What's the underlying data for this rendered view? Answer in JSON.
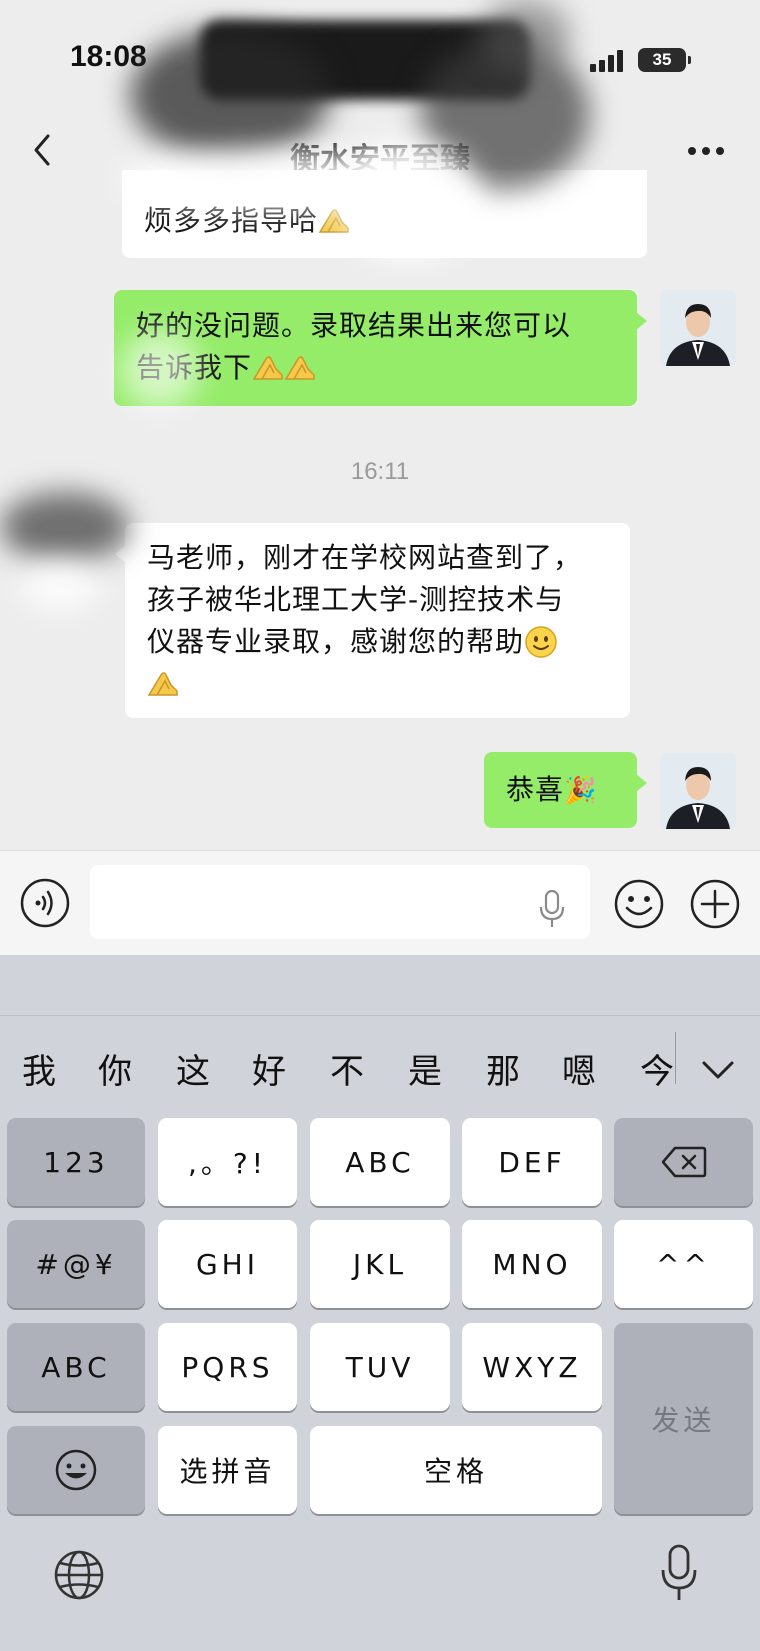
{
  "status_bar": {
    "time": "18:08",
    "battery": "35"
  },
  "nav": {
    "title": "衡水安平至臻"
  },
  "messages": {
    "m1_tail": "烦多多指导哈",
    "m2_line1": "好的没问题。录取结果出来您可以",
    "m2_line2": "告诉我下",
    "timestamp": "16:11",
    "m3_line1": "马老师，刚才在学校网站查到了，",
    "m3_line2": "孩子被华北理工大学-测控技术与",
    "m3_line3": "仪器专业录取，感谢您的帮助",
    "m4_text": "恭喜",
    "m4_emoji": "🎉"
  },
  "input": {
    "value": "",
    "placeholder": ""
  },
  "candidates": [
    "我",
    "你",
    "这",
    "好",
    "不",
    "是",
    "那",
    "嗯",
    "今"
  ],
  "keys": {
    "k123": "123",
    "punct": ",。?!",
    "abc": "ABC",
    "def": "DEF",
    "symbols": "#@¥",
    "ghi": "GHI",
    "jkl": "JKL",
    "mno": "MNO",
    "face": "^^",
    "abc_mode": "ABC",
    "pqrs": "PQRS",
    "tuv": "TUV",
    "wxyz": "WXYZ",
    "send": "发送",
    "pinyin": "选拼音",
    "space": "空格"
  },
  "colors": {
    "outgoing_bubble": "#95ec69",
    "incoming_bubble": "#ffffff",
    "chat_bg": "#ededed",
    "keyboard_bg": "#d1d3da"
  },
  "icons": [
    "back-icon",
    "more-icon",
    "voice-icon",
    "mic-icon",
    "emoji-icon",
    "plus-icon",
    "backspace-icon",
    "globe-icon",
    "chevron-down-icon"
  ]
}
